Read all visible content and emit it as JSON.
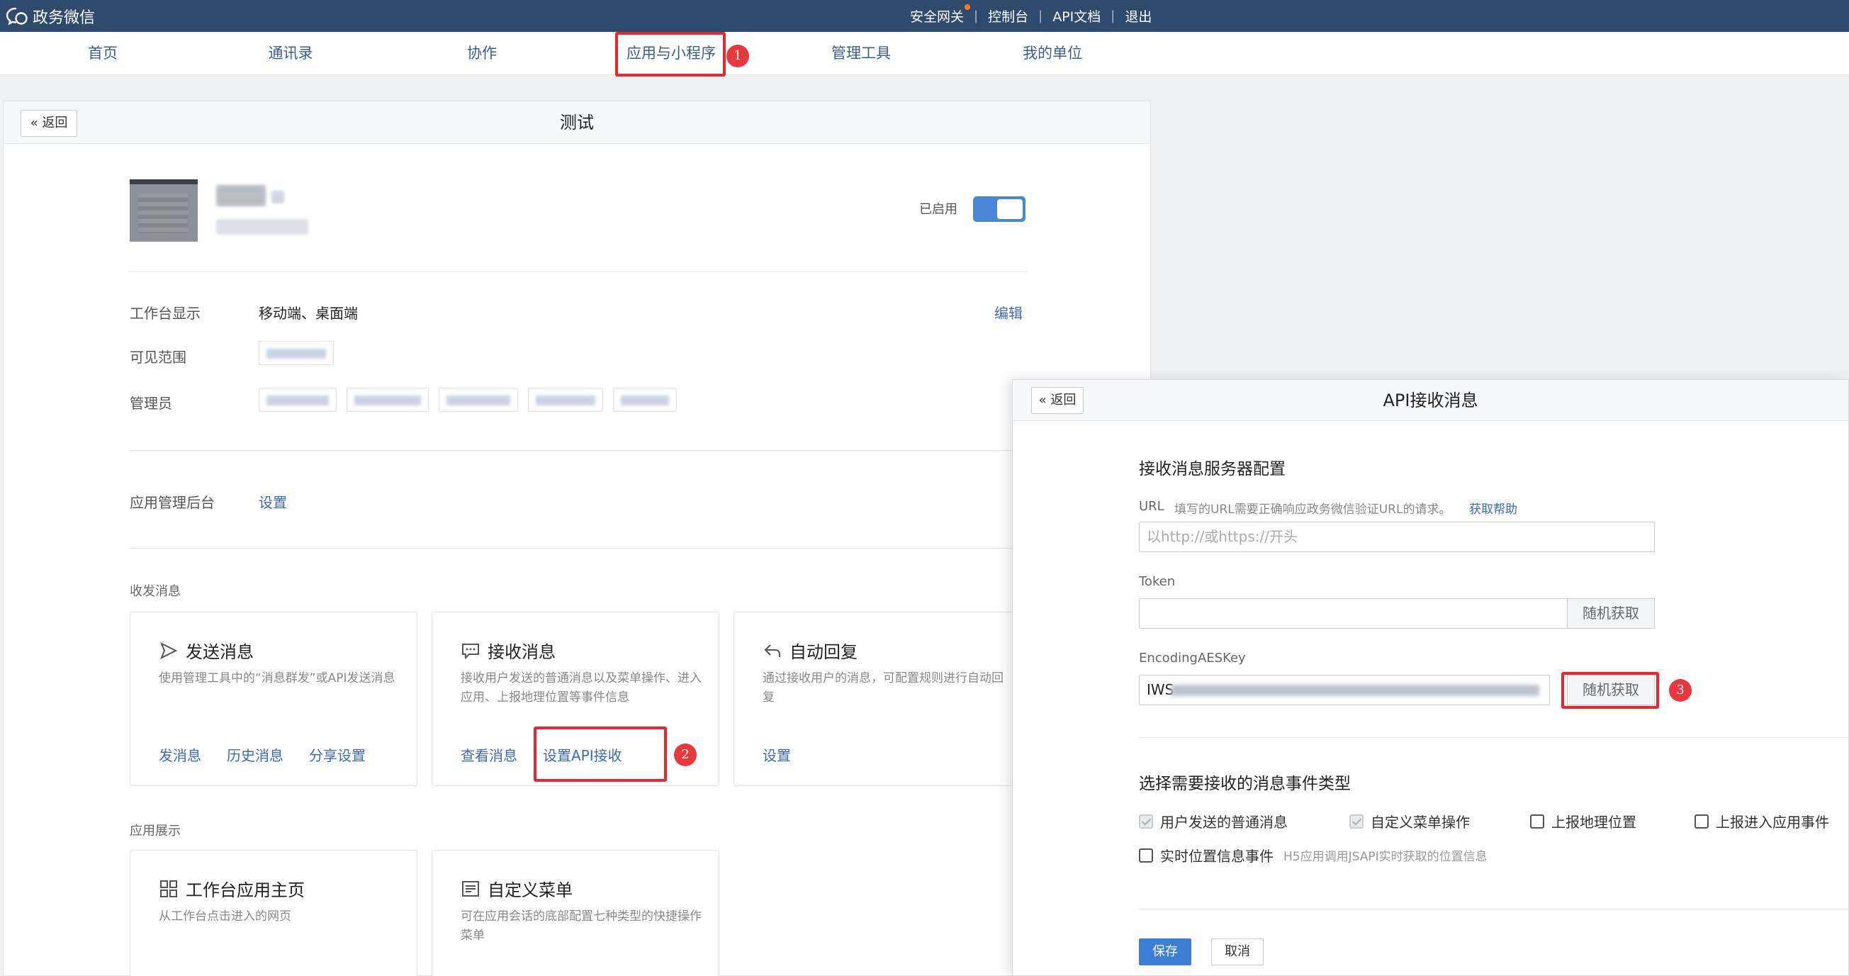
{
  "topbar": {
    "logo_text": "政务微信",
    "links": [
      "安全网关",
      "控制台",
      "API文档",
      "退出"
    ]
  },
  "nav": {
    "items": [
      "首页",
      "通讯录",
      "协作",
      "应用与小程序",
      "管理工具",
      "我的单位"
    ],
    "active": "应用与小程序"
  },
  "badges": [
    "1",
    "2",
    "3"
  ],
  "main": {
    "back_label": "返回",
    "title": "测试",
    "enabled_label": "已启用",
    "toggle_on": true,
    "workbench_label": "工作台显示",
    "workbench_value": "移动端、桌面端",
    "edit_label": "编辑",
    "visible_label": "可见范围",
    "admin_label": "管理员",
    "backend_label": "应用管理后台",
    "backend_link": "设置",
    "section_messages": "收发消息",
    "section_display": "应用展示",
    "cards": [
      {
        "title": "发送消息",
        "desc": "使用管理工具中的“消息群发”或API发送消息",
        "links": [
          "发消息",
          "历史消息",
          "分享设置"
        ],
        "icon": "send-icon"
      },
      {
        "title": "接收消息",
        "desc": "接收用户发送的普通消息以及菜单操作、进入应用、上报地理位置等事件信息",
        "links": [
          "查看消息",
          "设置API接收"
        ],
        "icon": "chat-icon"
      },
      {
        "title": "自动回复",
        "desc": "通过接收用户的消息，可配置规则进行自动回复",
        "links": [
          "设置"
        ],
        "icon": "reply-icon"
      },
      {
        "title": "工作台应用主页",
        "desc": "从工作台点击进入的网页",
        "links": [],
        "icon": "grid-icon"
      },
      {
        "title": "自定义菜单",
        "desc": "可在应用会话的底部配置七种类型的快捷操作菜单",
        "links": [],
        "icon": "menu-icon"
      }
    ]
  },
  "api_panel": {
    "back_label": "返回",
    "title": "API接收消息",
    "server_config_title": "接收消息服务器配置",
    "url_label": "URL",
    "url_hint": "填写的URL需要正确响应政务微信验证URL的请求。",
    "help_link": "获取帮助",
    "url_placeholder": "以http://或https://开头",
    "token_label": "Token",
    "random_label": "随机获取",
    "aes_label": "EncodingAESKey",
    "aes_value_prefix": "IWS",
    "event_title": "选择需要接收的消息事件类型",
    "events": [
      {
        "label": "用户发送的普通消息",
        "checked": true,
        "disabled": true
      },
      {
        "label": "自定义菜单操作",
        "checked": true,
        "disabled": true
      },
      {
        "label": "上报地理位置",
        "checked": false,
        "disabled": false
      },
      {
        "label": "上报进入应用事件",
        "checked": false,
        "disabled": false
      },
      {
        "label": "实时位置信息事件",
        "checked": false,
        "disabled": false
      }
    ],
    "realtime_hint": "H5应用调用JSAPI实时获取的位置信息",
    "save_label": "保存",
    "cancel_label": "取消"
  }
}
